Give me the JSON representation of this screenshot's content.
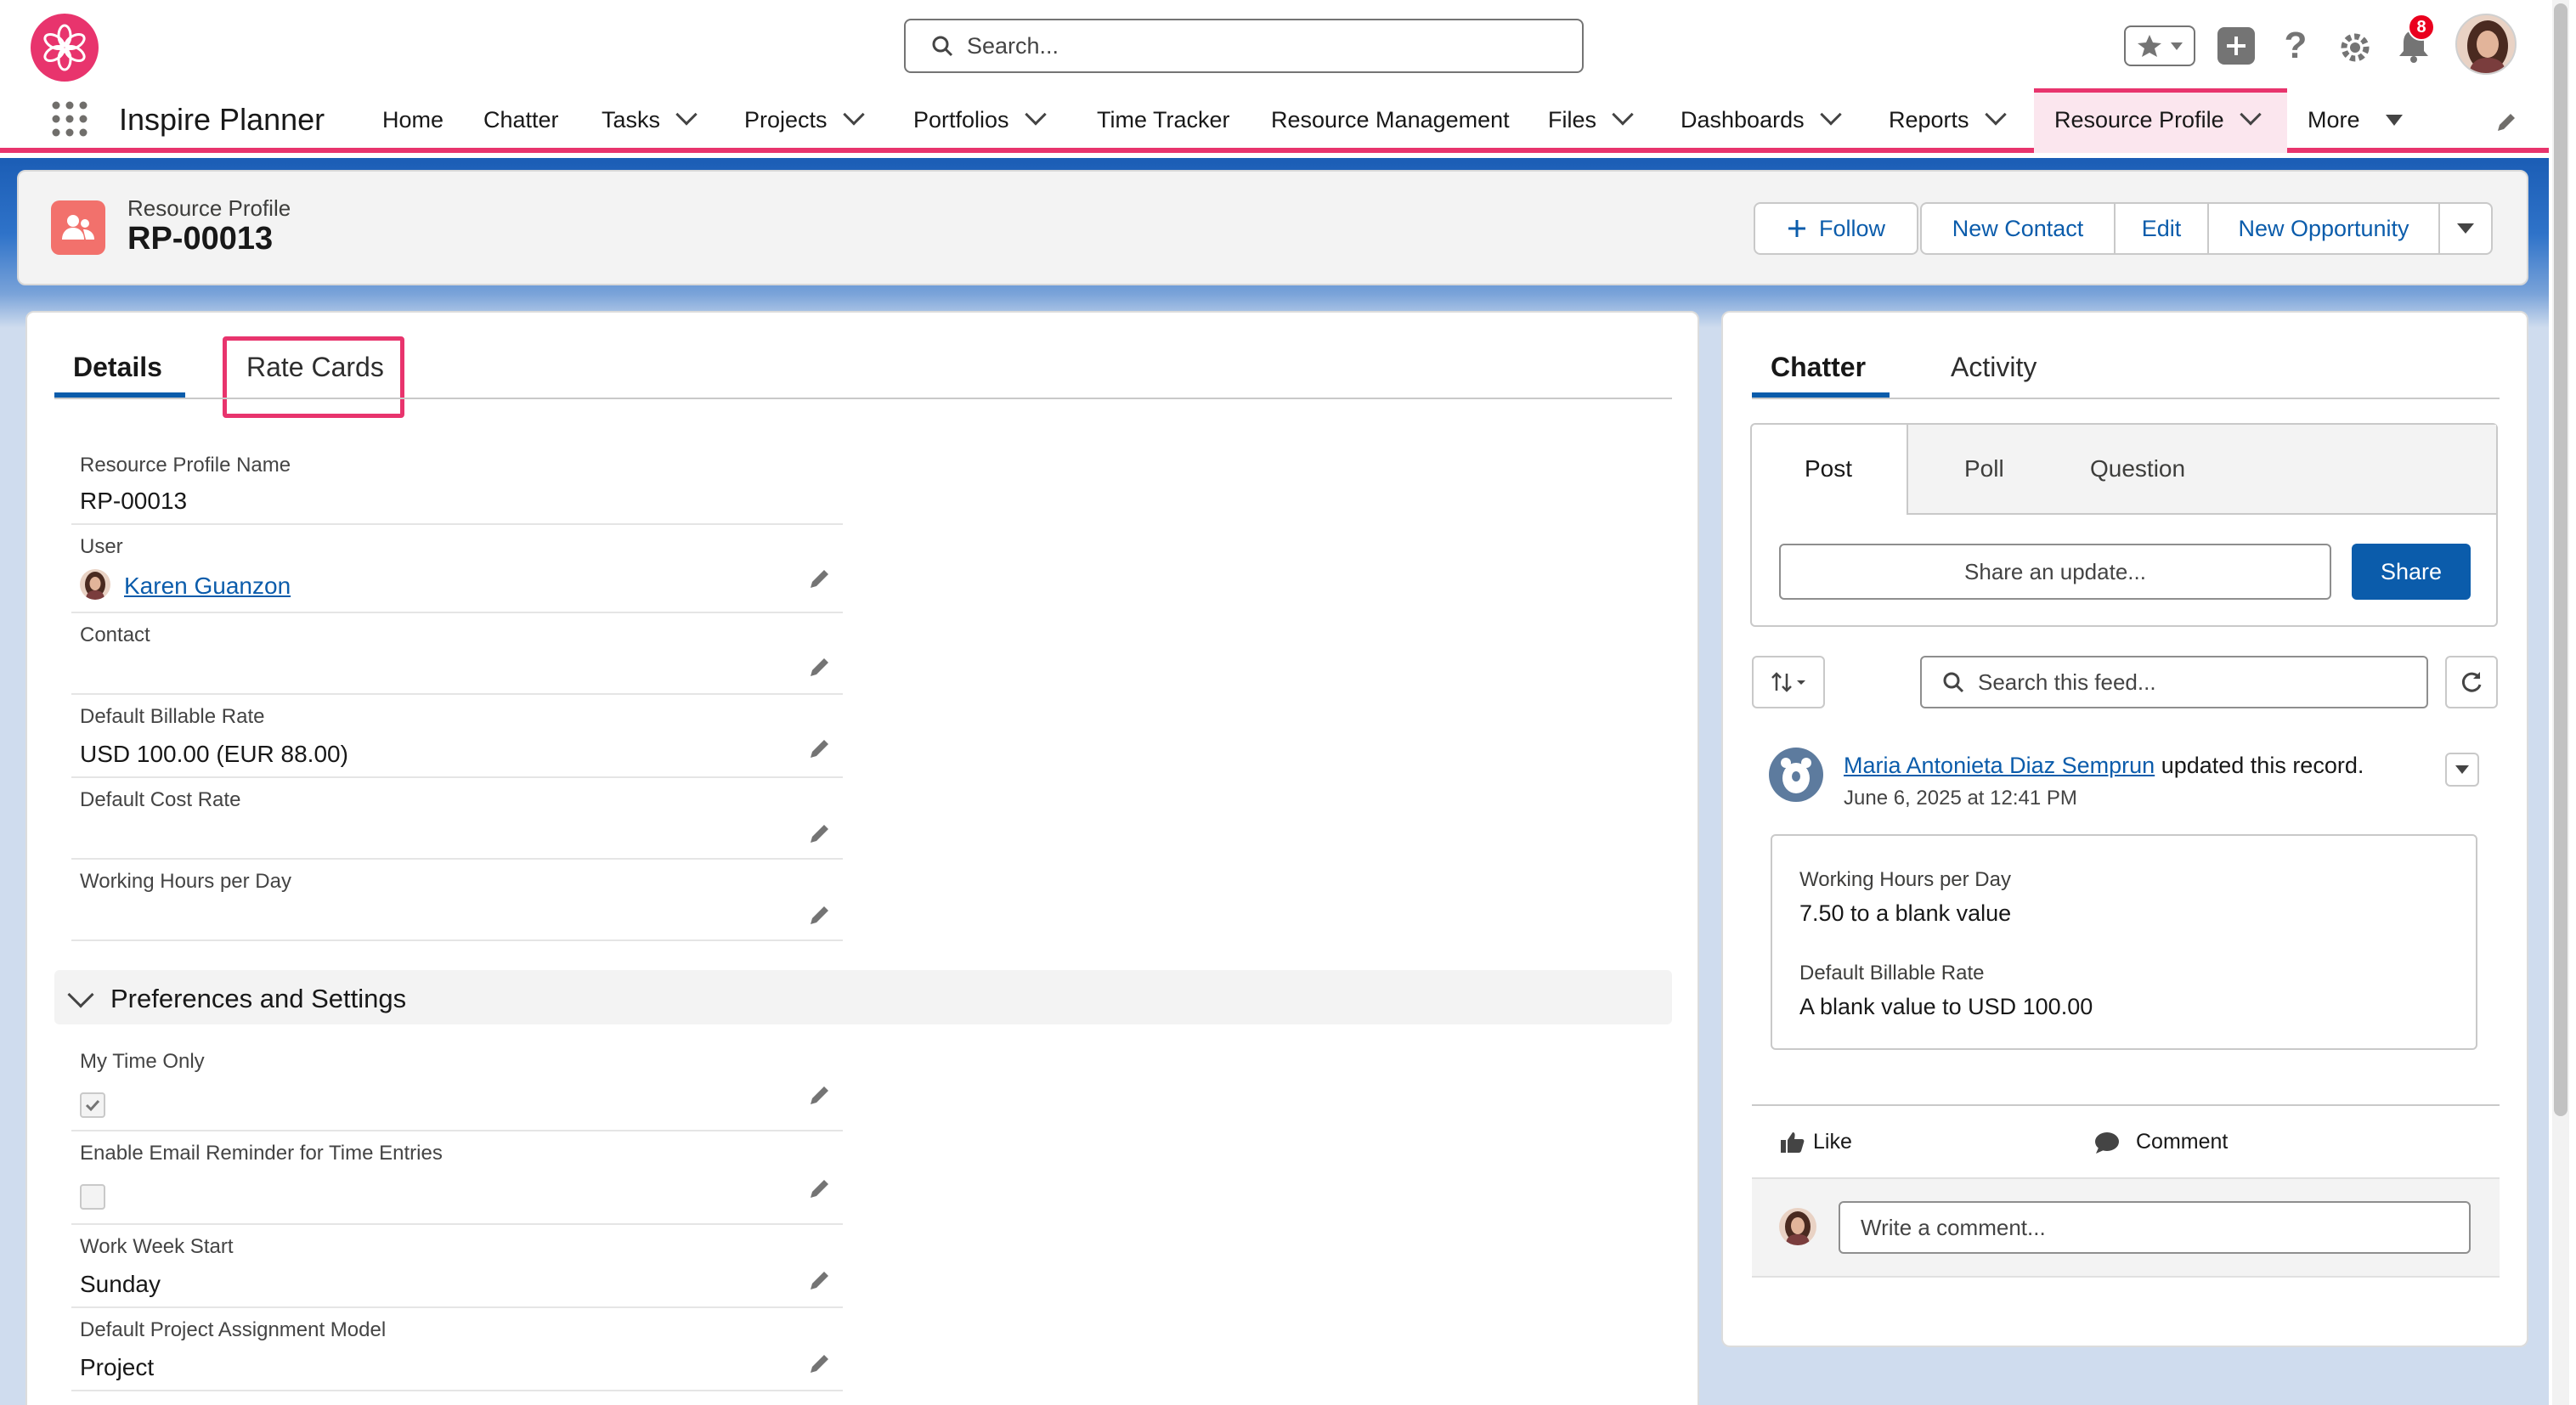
{
  "app": {
    "name": "Inspire Planner",
    "search_placeholder": "Search...",
    "notification_count": "8",
    "accent": "#e8346d",
    "link_color": "#0b5cab"
  },
  "nav": {
    "items": [
      {
        "label": "Home",
        "dropdown": false
      },
      {
        "label": "Chatter",
        "dropdown": false
      },
      {
        "label": "Tasks",
        "dropdown": true
      },
      {
        "label": "Projects",
        "dropdown": true
      },
      {
        "label": "Portfolios",
        "dropdown": true
      },
      {
        "label": "Time Tracker",
        "dropdown": false
      },
      {
        "label": "Resource Management",
        "dropdown": false
      },
      {
        "label": "Files",
        "dropdown": true
      },
      {
        "label": "Dashboards",
        "dropdown": true
      },
      {
        "label": "Reports",
        "dropdown": true
      },
      {
        "label": "Resource Profile",
        "dropdown": true,
        "active": true
      },
      {
        "label": "More",
        "dropdown": true
      }
    ]
  },
  "record": {
    "object_label": "Resource Profile",
    "name": "RP-00013",
    "actions": {
      "follow": "Follow",
      "new_contact": "New Contact",
      "edit": "Edit",
      "new_opportunity": "New Opportunity"
    }
  },
  "tabs": {
    "details": "Details",
    "rate_cards": "Rate Cards"
  },
  "fields": {
    "resource_profile_name": {
      "label": "Resource Profile Name",
      "value": "RP-00013"
    },
    "user": {
      "label": "User",
      "value": "Karen Guanzon"
    },
    "contact": {
      "label": "Contact",
      "value": ""
    },
    "default_billable_rate": {
      "label": "Default Billable Rate",
      "value": "USD 100.00 (EUR 88.00)"
    },
    "default_cost_rate": {
      "label": "Default Cost Rate",
      "value": ""
    },
    "working_hours": {
      "label": "Working Hours per Day",
      "value": ""
    }
  },
  "preferences": {
    "title": "Preferences and Settings",
    "my_time_only": {
      "label": "My Time Only",
      "checked": true
    },
    "email_reminder": {
      "label": "Enable Email Reminder for Time Entries",
      "checked": false
    },
    "work_week_start": {
      "label": "Work Week Start",
      "value": "Sunday"
    },
    "assignment_model": {
      "label": "Default Project Assignment Model",
      "value": "Project"
    }
  },
  "chatter": {
    "tabs": {
      "chatter": "Chatter",
      "activity": "Activity"
    },
    "publisher_tabs": {
      "post": "Post",
      "poll": "Poll",
      "question": "Question"
    },
    "share_placeholder": "Share an update...",
    "share_button": "Share",
    "feed_search_placeholder": "Search this feed...",
    "feed_item": {
      "author": "Maria Antonieta Diaz Semprun",
      "action": "updated this record.",
      "timestamp": "June 6, 2025 at 12:41 PM",
      "changes": [
        {
          "field": "Working Hours per Day",
          "change": "7.50 to a blank value"
        },
        {
          "field": "Default Billable Rate",
          "change": "A blank value to USD 100.00"
        }
      ],
      "like": "Like",
      "comment": "Comment",
      "comment_placeholder": "Write a comment..."
    }
  }
}
